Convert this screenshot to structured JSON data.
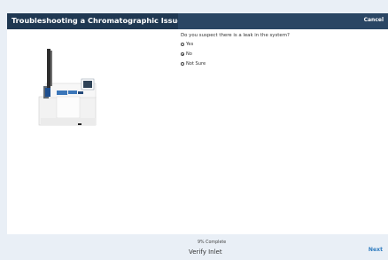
{
  "header": {
    "title": "Troubleshooting a Chromatographic Issue",
    "cancel_label": "Cancel"
  },
  "question": {
    "text": "Do you suspect there is a leak in the system?",
    "options": [
      {
        "label": "Yes",
        "selected": false
      },
      {
        "label": "No",
        "selected": true
      },
      {
        "label": "Not Sure",
        "selected": false
      }
    ]
  },
  "footer": {
    "progress_text": "9% Complete",
    "step_title": "Verify Inlet",
    "next_label": "Next"
  },
  "colors": {
    "header_dark": "#1f3852",
    "header_right": "#2a4664",
    "background": "#e9eff6",
    "link": "#2e7bbf"
  }
}
